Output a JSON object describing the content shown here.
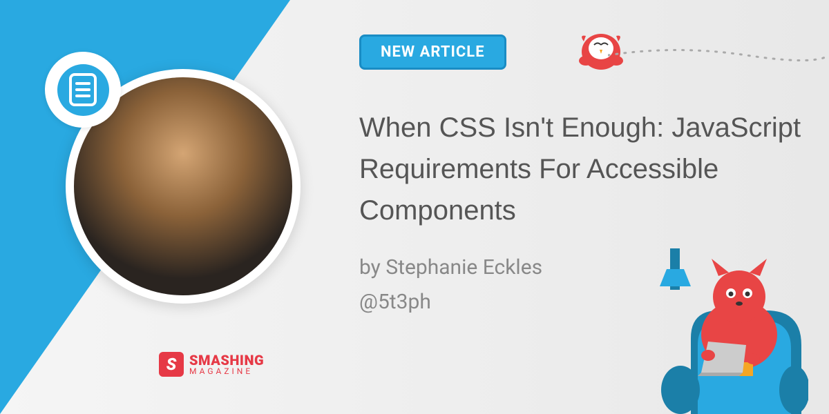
{
  "badge": {
    "label": "NEW ARTICLE"
  },
  "article": {
    "title": "When CSS Isn't Enough: JavaScript Requirements For Accessible Components",
    "byline": "by Stephanie Eckles",
    "handle": "@5t3ph"
  },
  "brand": {
    "logo_letter": "S",
    "name_main": "SMASHING",
    "name_sub": "MAGAZINE"
  },
  "icons": {
    "document": "document-icon",
    "bird": "bird-mascot",
    "cat": "cat-mascot"
  },
  "colors": {
    "accent": "#29a9e1",
    "brand": "#e63946",
    "text": "#555",
    "muted": "#888"
  }
}
